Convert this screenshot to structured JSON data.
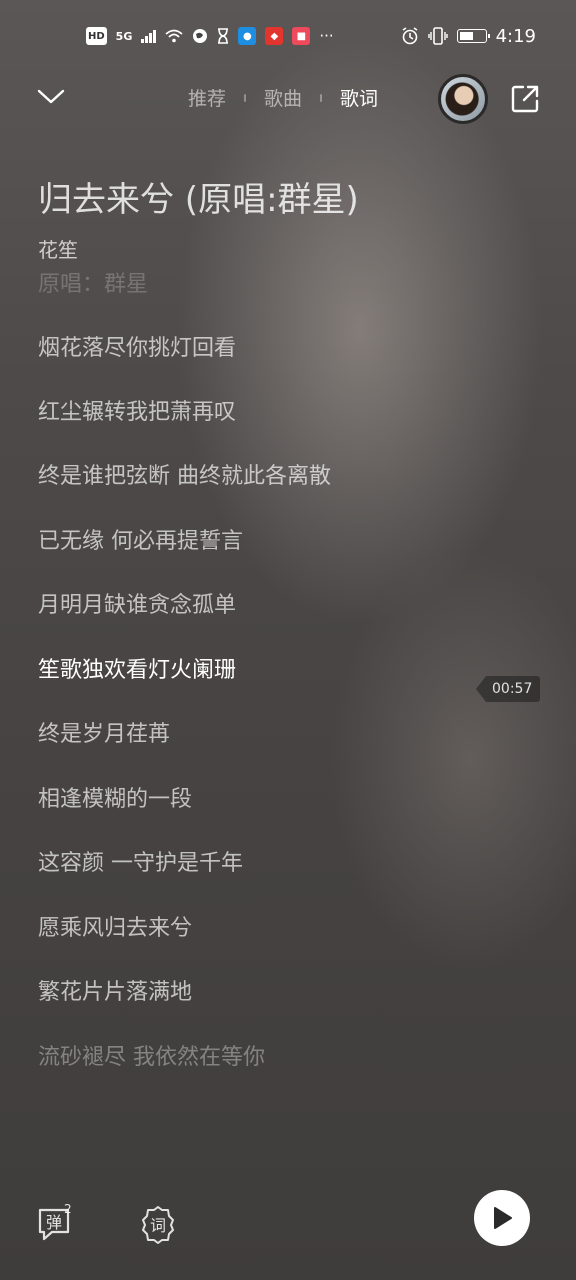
{
  "status_bar": {
    "hd": "HD",
    "network": "5G",
    "time": "4:19",
    "battery_level": 0.55,
    "icons": [
      "hd-icon",
      "signal-icon",
      "wifi-icon",
      "vpn-icon",
      "hourglass-icon",
      "app-blue-icon",
      "app-red-icon",
      "app-pink-icon",
      "more-icon",
      "alarm-icon",
      "vibrate-icon",
      "battery-icon"
    ]
  },
  "nav": {
    "tabs": [
      "推荐",
      "歌曲",
      "歌词"
    ],
    "active_tab": "歌词"
  },
  "song": {
    "title": "归去来兮 (原唱:群星)",
    "artist": "花笙"
  },
  "lyrics": {
    "lines": [
      "原唱：群星",
      "烟花落尽你挑灯回看",
      "红尘辗转我把萧再叹",
      "终是谁把弦断 曲终就此各离散",
      "已无缘 何必再提誓言",
      "月明月缺谁贪念孤单",
      "笙歌独欢看灯火阑珊",
      "终是岁月荏苒",
      "相逢模糊的一段",
      "这容颜 一守护是千年",
      "愿乘风归去来兮",
      "繁花片片落满地",
      "流砂褪尽 我依然在等你"
    ],
    "active_index": 6,
    "current_time": "00:57"
  },
  "bottom": {
    "danmu_label": "弹",
    "danmu_count": "2",
    "lyric_label": "词"
  },
  "colors": {
    "background": "#4a4746",
    "active_text": "#ffffff"
  }
}
